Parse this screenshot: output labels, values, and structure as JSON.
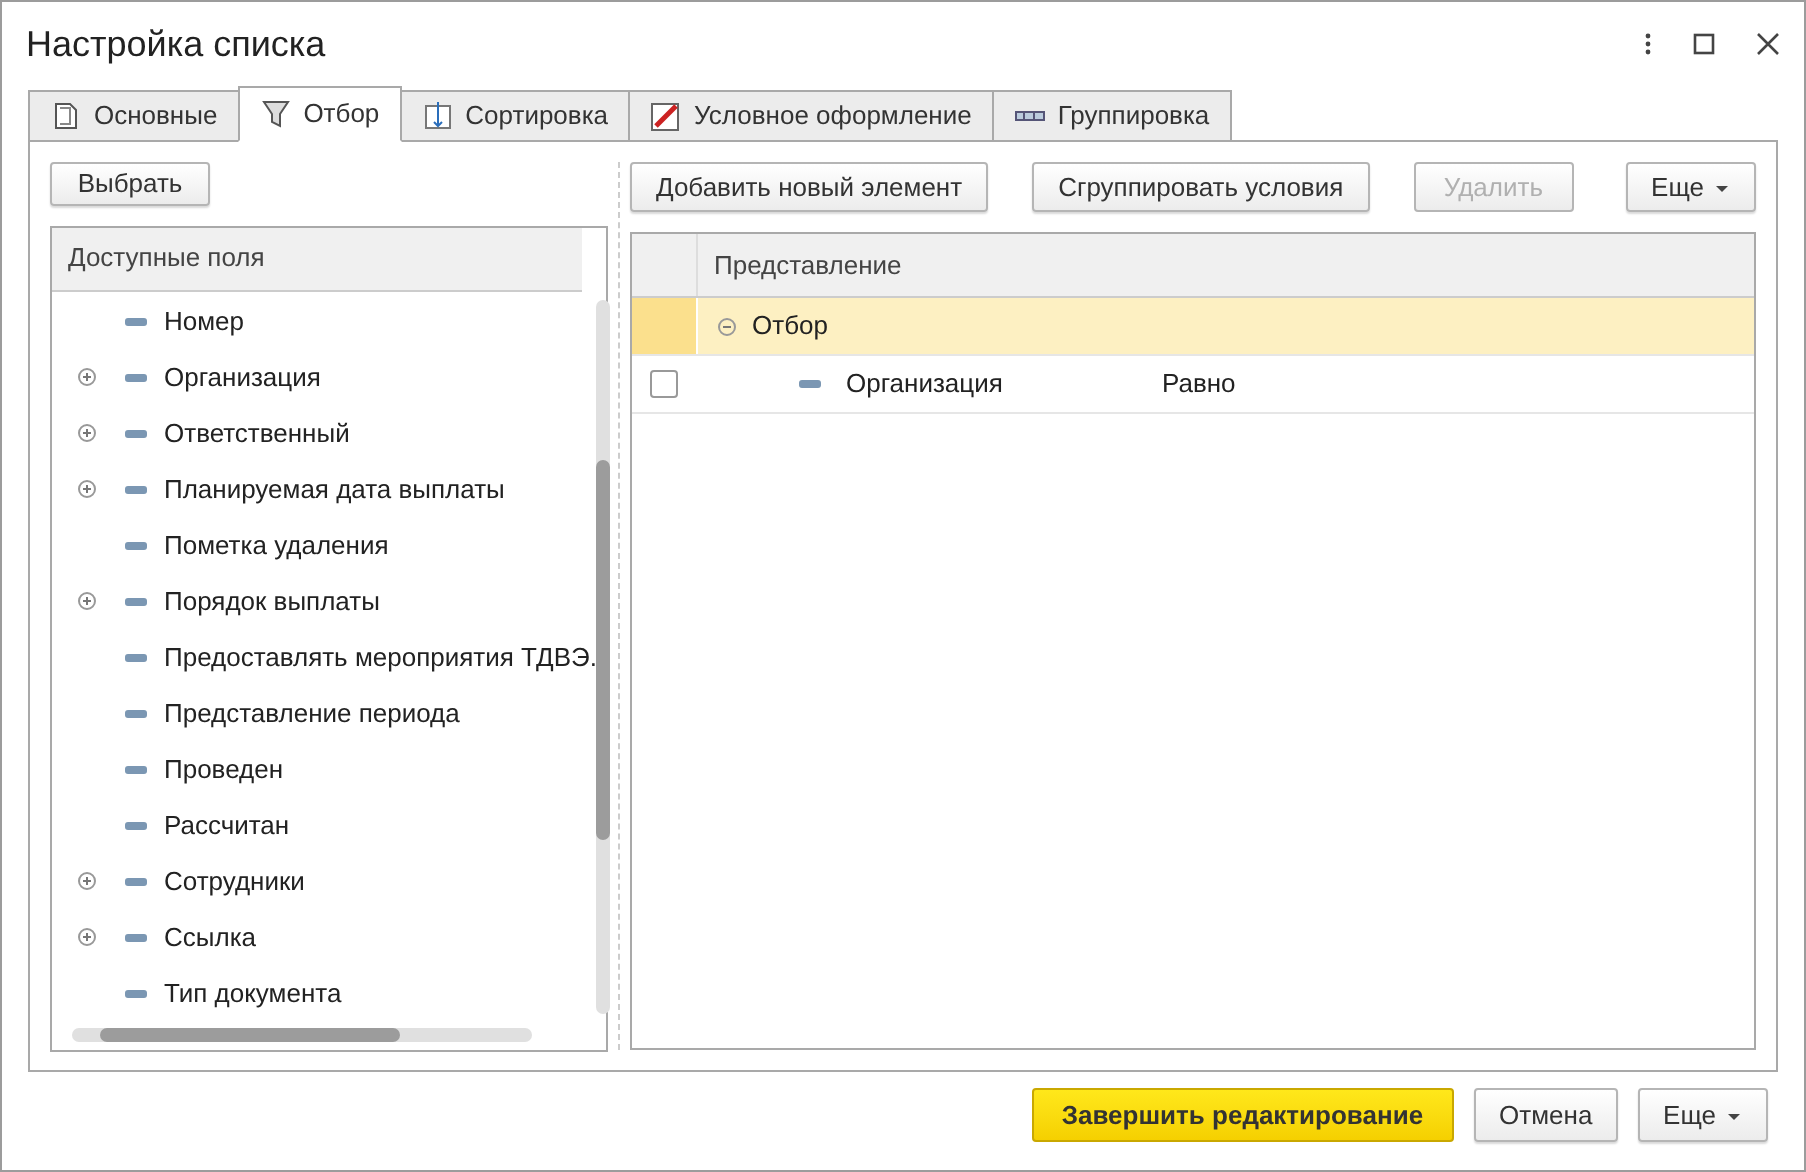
{
  "window": {
    "title": "Настройка списка"
  },
  "tabs": [
    {
      "label": "Основные",
      "selected": false
    },
    {
      "label": "Отбор",
      "selected": true
    },
    {
      "label": "Сортировка",
      "selected": false
    },
    {
      "label": "Условное оформление",
      "selected": false
    },
    {
      "label": "Группировка",
      "selected": false
    }
  ],
  "left": {
    "button": "Выбрать",
    "header": "Доступные поля",
    "items": [
      {
        "label": "Номер",
        "expandable": false
      },
      {
        "label": "Организация",
        "expandable": true
      },
      {
        "label": "Ответственный",
        "expandable": true
      },
      {
        "label": "Планируемая дата выплаты",
        "expandable": true
      },
      {
        "label": "Пометка удаления",
        "expandable": false
      },
      {
        "label": "Порядок выплаты",
        "expandable": true
      },
      {
        "label": "Предоставлять мероприятия ТДВЭ.",
        "expandable": false
      },
      {
        "label": "Представление периода",
        "expandable": false
      },
      {
        "label": "Проведен",
        "expandable": false
      },
      {
        "label": "Рассчитан",
        "expandable": false
      },
      {
        "label": "Сотрудники",
        "expandable": true
      },
      {
        "label": "Ссылка",
        "expandable": true
      },
      {
        "label": "Тип документа",
        "expandable": false
      }
    ]
  },
  "right": {
    "buttons": [
      {
        "label": "Добавить новый элемент",
        "disabled": false
      },
      {
        "label": "Сгруппировать условия",
        "disabled": false
      },
      {
        "label": "Удалить",
        "disabled": true
      }
    ],
    "more": "Еще",
    "column": "Представление",
    "rows": [
      {
        "kind": "group",
        "label": "Отбор",
        "expanded": true,
        "selected": true
      },
      {
        "kind": "item",
        "label": "Организация",
        "condition": "Равно",
        "checked": false,
        "selected": false
      }
    ]
  },
  "footer": {
    "primary": "Завершить редактирование",
    "cancel": "Отмена",
    "more": "Еще"
  }
}
